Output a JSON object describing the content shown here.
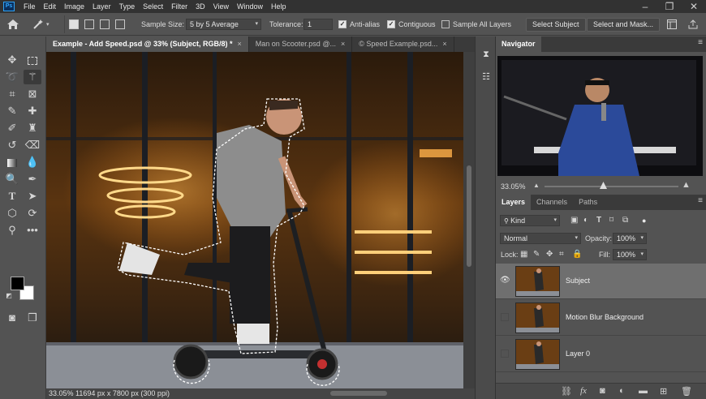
{
  "menu": {
    "logo": "Ps",
    "items": [
      "File",
      "Edit",
      "Image",
      "Layer",
      "Type",
      "Select",
      "Filter",
      "3D",
      "View",
      "Window",
      "Help"
    ],
    "window_controls": [
      "–",
      "❐",
      "✕"
    ]
  },
  "options_bar": {
    "sample_size_label": "Sample Size:",
    "sample_size_value": "5 by 5 Average",
    "tolerance_label": "Tolerance:",
    "tolerance_value": "1",
    "anti_alias_label": "Anti-alias",
    "anti_alias_checked": true,
    "contiguous_label": "Contiguous",
    "contiguous_checked": true,
    "sample_all_layers_label": "Sample All Layers",
    "sample_all_layers_checked": false,
    "select_subject_label": "Select Subject",
    "select_and_mask_label": "Select and Mask..."
  },
  "tabs": [
    {
      "label": "Example - Add Speed.psd @ 33% (Subject, RGB/8) *",
      "active": true
    },
    {
      "label": "Man on Scooter.psd @...",
      "active": false
    },
    {
      "label": "© Speed Example.psd...",
      "active": false
    }
  ],
  "tab_close": "×",
  "status": {
    "text": "33.05% 11694 px x 7800 px (300 ppi)"
  },
  "navigator": {
    "title": "Navigator",
    "zoom": "33.05%"
  },
  "layers_panel": {
    "tabs": [
      "Layers",
      "Channels",
      "Paths"
    ],
    "filter_kind": "Kind",
    "blend_mode": "Normal",
    "opacity_label": "Opacity:",
    "opacity_value": "100%",
    "lock_label": "Lock:",
    "fill_label": "Fill:",
    "fill_value": "100%",
    "layers": [
      {
        "name": "Subject",
        "visible": true,
        "selected": true
      },
      {
        "name": "Motion Blur Background",
        "visible": false,
        "selected": false
      },
      {
        "name": "Layer 0",
        "visible": false,
        "selected": false
      }
    ]
  },
  "colors": {
    "foreground": "#000000",
    "background": "#ffffff"
  }
}
